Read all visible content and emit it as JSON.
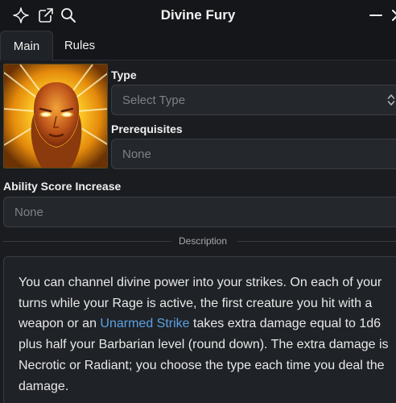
{
  "window": {
    "title": "Divine Fury",
    "icons": [
      "sparkle-icon",
      "external-link-icon",
      "search-icon",
      "minimize-icon"
    ]
  },
  "tabs": [
    {
      "label": "Main",
      "active": true
    },
    {
      "label": "Rules",
      "active": false
    }
  ],
  "form": {
    "type": {
      "label": "Type",
      "placeholder": "Select Type"
    },
    "prerequisites": {
      "label": "Prerequisites",
      "placeholder": "None"
    },
    "ability_score": {
      "label": "Ability Score Increase",
      "placeholder": "None"
    }
  },
  "description": {
    "heading": "Description",
    "text_before_link": "You can channel divine power into your strikes. On each of your turns while your Rage is active, the first creature you hit with a weapon or an ",
    "link_text": "Unarmed Strike",
    "text_after_link": " takes extra damage equal to 1d6 plus half your Barbarian level (round down). The extra damage is Necrotic or Radiant; you choose the type each time you deal the damage."
  },
  "colors": {
    "background": "#1a1c20",
    "titlebar": "#141619",
    "field": "#24272b",
    "link": "#5aa2e6"
  }
}
